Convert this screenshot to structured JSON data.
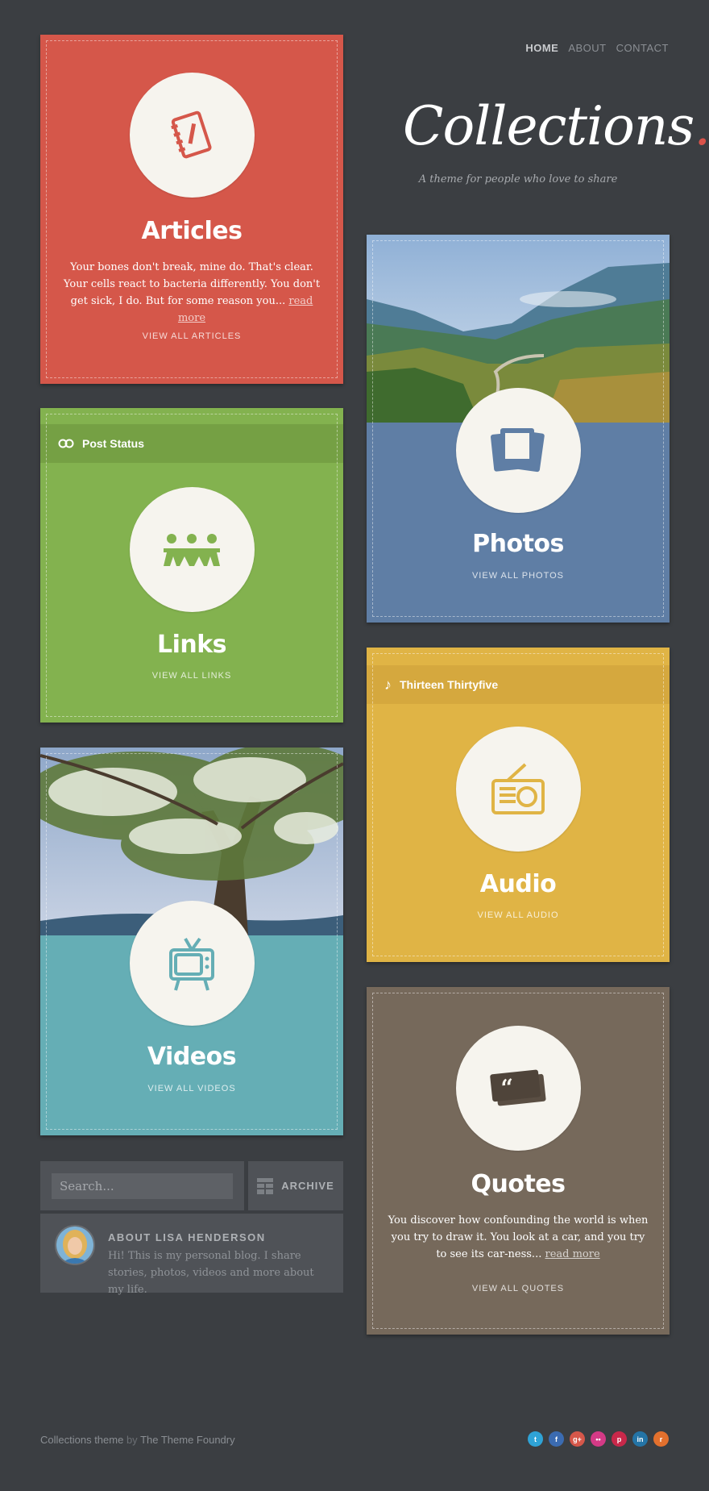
{
  "nav": {
    "home": "HOME",
    "about": "ABOUT",
    "contact": "CONTACT"
  },
  "site": {
    "title": "Collections",
    "title_dot": ".",
    "tagline": "A theme for people who love to share"
  },
  "cards": {
    "articles": {
      "title": "Articles",
      "excerpt": "Your bones don't break, mine do. That's clear. Your cells react to bacteria differently. You don't get sick, I do. But for some reason you...",
      "more": "read more",
      "view_all": "VIEW ALL ARTICLES",
      "color": "#d5574a",
      "icon": "notebook-icon"
    },
    "links": {
      "status": "Post Status",
      "title": "Links",
      "view_all": "VIEW ALL LINKS",
      "color": "#83b24f",
      "icon": "paper-people-icon"
    },
    "photos": {
      "title": "Photos",
      "view_all": "VIEW ALL PHOTOS",
      "color": "#5f7ea5",
      "icon": "photos-icon"
    },
    "audio": {
      "status": "Thirteen Thirtyfive",
      "title": "Audio",
      "view_all": "VIEW ALL AUDIO",
      "color": "#e0b445",
      "icon": "radio-icon"
    },
    "videos": {
      "title": "Videos",
      "view_all": "VIEW ALL VIDEOS",
      "color": "#65aeb5",
      "icon": "tv-icon"
    },
    "quotes": {
      "title": "Quotes",
      "excerpt": "You discover how confounding the world is when you try to draw it. You look at a car, and you try to see its car-ness...",
      "more": "read more",
      "view_all": "VIEW ALL QUOTES",
      "color": "#76695b",
      "icon": "quote-icon"
    }
  },
  "search": {
    "placeholder": "Search..."
  },
  "archive": {
    "label": "ARCHIVE"
  },
  "about": {
    "title": "ABOUT LISA HENDERSON",
    "text": "Hi! This is my personal blog. I share stories, photos, videos and more about my life."
  },
  "footer": {
    "theme": "Collections theme",
    "by": "by",
    "author": "The Theme Foundry"
  },
  "social": [
    {
      "name": "twitter",
      "glyph": "t",
      "color": "#2fa3d6"
    },
    {
      "name": "facebook",
      "glyph": "f",
      "color": "#3b6bb1"
    },
    {
      "name": "google-plus",
      "glyph": "g+",
      "color": "#d5574a"
    },
    {
      "name": "flickr",
      "glyph": "••",
      "color": "#d43a86"
    },
    {
      "name": "pinterest",
      "glyph": "p",
      "color": "#c8284a"
    },
    {
      "name": "linkedin",
      "glyph": "in",
      "color": "#2474a6"
    },
    {
      "name": "rss",
      "glyph": "r",
      "color": "#e3702d"
    }
  ]
}
